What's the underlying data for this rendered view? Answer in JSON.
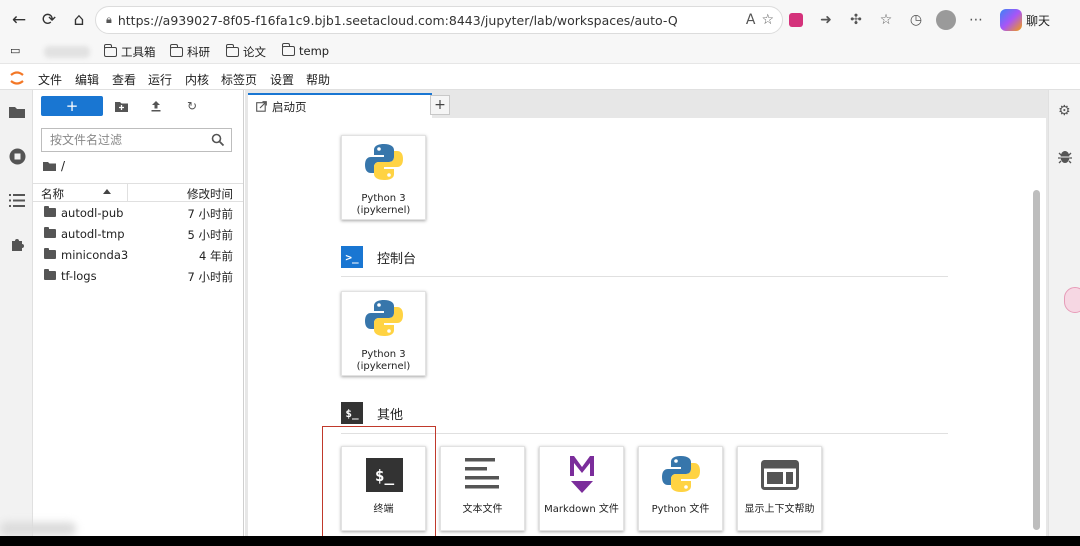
{
  "browser": {
    "url": "https://a939027-8f05-f16fa1c9.bjb1.seetacloud.com:8443/jupyter/lab/workspaces/auto-Q",
    "chat_label": "聊天",
    "bookmarks": [
      "工具箱",
      "科研",
      "论文",
      "temp"
    ]
  },
  "menubar": {
    "items": [
      "文件",
      "编辑",
      "查看",
      "运行",
      "内核",
      "标签页",
      "设置",
      "帮助"
    ]
  },
  "filebrowser": {
    "new_label": "+",
    "filter_placeholder": "按文件名过滤",
    "breadcrumb": "/",
    "col_name": "名称",
    "col_modified": "修改时间",
    "files": [
      {
        "name": "autodl-pub",
        "time": "7 小时前"
      },
      {
        "name": "autodl-tmp",
        "time": "5 小时前"
      },
      {
        "name": "miniconda3",
        "time": "4 年前"
      },
      {
        "name": "tf-logs",
        "time": "7 小时前"
      }
    ]
  },
  "main": {
    "tab_label": "启动页",
    "add_tab": "+",
    "notebook_card": {
      "title": "Python 3",
      "subtitle": "(ipykernel)"
    },
    "console_section": "控制台",
    "console_card": {
      "title": "Python 3",
      "subtitle": "(ipykernel)"
    },
    "other_section": "其他",
    "other_cards": [
      "终端",
      "文本文件",
      "Markdown 文件",
      "Python 文件",
      "显示上下文帮助"
    ]
  },
  "colors": {
    "accent": "#1976d2",
    "highlight": "#c0392b",
    "python_blue": "#3776ab",
    "python_yellow": "#ffd343",
    "markdown_purple": "#7b2d9b"
  }
}
